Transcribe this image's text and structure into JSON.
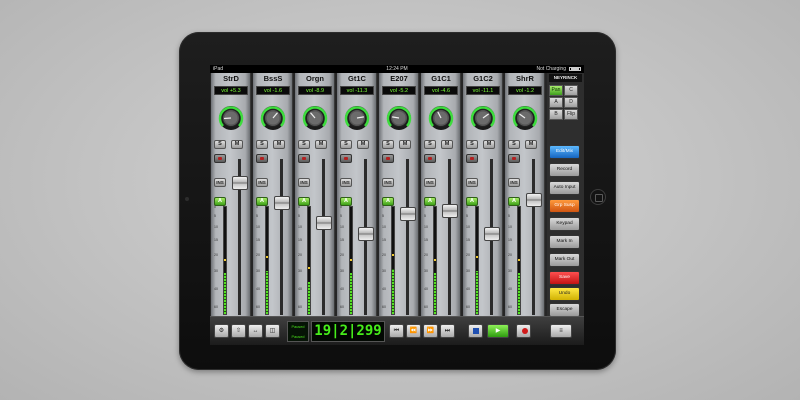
{
  "statusbar": {
    "device": "iPad",
    "time": "12:24 PM",
    "charging": "Not Charging"
  },
  "channels": [
    {
      "name": "StrD",
      "vol": "vol +5.3",
      "fader": 0.88,
      "meter": 0.38,
      "pan": 0.15
    },
    {
      "name": "BssS",
      "vol": "vol -1.6",
      "fader": 0.74,
      "meter": 0.4,
      "pan": 0.65
    },
    {
      "name": "Orgn",
      "vol": "vol -8.9",
      "fader": 0.6,
      "meter": 0.3,
      "pan": 0.35
    },
    {
      "name": "Gt1C",
      "vol": "vol -11.3",
      "fader": 0.52,
      "meter": 0.38,
      "pan": 0.8
    },
    {
      "name": "E207",
      "vol": "vol -5.2",
      "fader": 0.66,
      "meter": 0.42,
      "pan": 0.2
    },
    {
      "name": "G1C1",
      "vol": "vol -4.6",
      "fader": 0.68,
      "meter": 0.38,
      "pan": 0.4
    },
    {
      "name": "G1C2",
      "vol": "vol -11.1",
      "fader": 0.52,
      "meter": 0.4,
      "pan": 0.7
    },
    {
      "name": "ShrR",
      "vol": "vol -1.2",
      "fader": 0.76,
      "meter": 0.38,
      "pan": 0.3
    }
  ],
  "strip_buttons": {
    "solo": "S",
    "mute": "M",
    "insert": "INS",
    "automation": "A"
  },
  "scale_marks": [
    "0",
    "5",
    "10",
    "15",
    "20",
    "30",
    "40",
    "60"
  ],
  "side_panel": {
    "logo": "NEYRINCK",
    "bank": [
      "Pan",
      "C",
      "A",
      "D",
      "B",
      "Flip"
    ],
    "buttons": [
      {
        "label": "Edit/Mix",
        "color": "blue"
      },
      {
        "label": "Record",
        "color": "gray"
      },
      {
        "label": "Auto Input",
        "color": "gray"
      },
      {
        "label": "Grp Susp",
        "color": "orange"
      },
      {
        "label": "Keypad",
        "color": "gray"
      },
      {
        "label": "Mark In",
        "color": "gray"
      },
      {
        "label": "Mark Out",
        "color": "gray"
      },
      {
        "label": "Save",
        "color": "red"
      },
      {
        "label": "Undo",
        "color": "yellow"
      },
      {
        "label": "Escape",
        "color": "gray"
      }
    ]
  },
  "transport": {
    "counter": "19|2|299",
    "mode_top": "Paused",
    "mode_bottom": "Paused"
  }
}
